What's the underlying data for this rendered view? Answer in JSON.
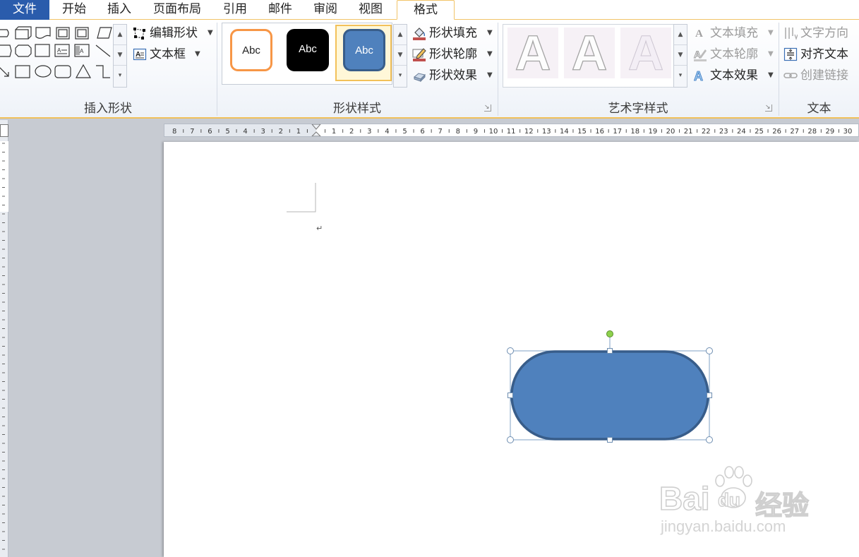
{
  "tabs": {
    "file": "文件",
    "items": [
      "开始",
      "插入",
      "页面布局",
      "引用",
      "邮件",
      "审阅",
      "视图"
    ],
    "active": "格式"
  },
  "insert_shapes": {
    "label": "插入形状",
    "edit_shape": "编辑形状",
    "text_box": "文本框"
  },
  "shape_styles": {
    "label": "形状样式",
    "swatches": [
      "Abc",
      "Abc",
      "Abc"
    ],
    "fill": "形状填充",
    "outline": "形状轮廓",
    "effects": "形状效果"
  },
  "wordart_styles": {
    "label": "艺术字样式",
    "samples": [
      "A",
      "A",
      "A"
    ],
    "text_fill": "文本填充",
    "text_outline": "文本轮廓",
    "text_effects": "文本效果"
  },
  "text_group": {
    "label": "文本",
    "direction": "文字方向",
    "align": "对齐文本",
    "link": "创建链接"
  },
  "ruler": {
    "left_numbers": [
      "8",
      "7",
      "6",
      "5",
      "4",
      "3",
      "2",
      "1"
    ],
    "right_numbers": [
      "1",
      "2",
      "3",
      "4",
      "5",
      "6",
      "7",
      "8",
      "9",
      "10",
      "11",
      "12",
      "13",
      "14",
      "15",
      "16",
      "17",
      "18",
      "19",
      "20",
      "21",
      "22",
      "23",
      "24",
      "25",
      "26",
      "27",
      "28",
      "29",
      "30"
    ]
  },
  "document": {
    "paragraph_mark": "↵",
    "shape": {
      "type": "rounded-rectangle",
      "fill": "#4f81bd",
      "outline": "#385d8a"
    }
  },
  "watermark": {
    "brand_latin": "Bai",
    "brand_du": "du",
    "brand_cn": "经验",
    "url": "jingyan.baidu.com"
  },
  "colors": {
    "file_tab": "#2a5cac",
    "accent_border": "#f0c05b",
    "orange_outline": "#f79646",
    "shape_fill": "#4f81bd",
    "handle_green": "#8ed14d"
  }
}
